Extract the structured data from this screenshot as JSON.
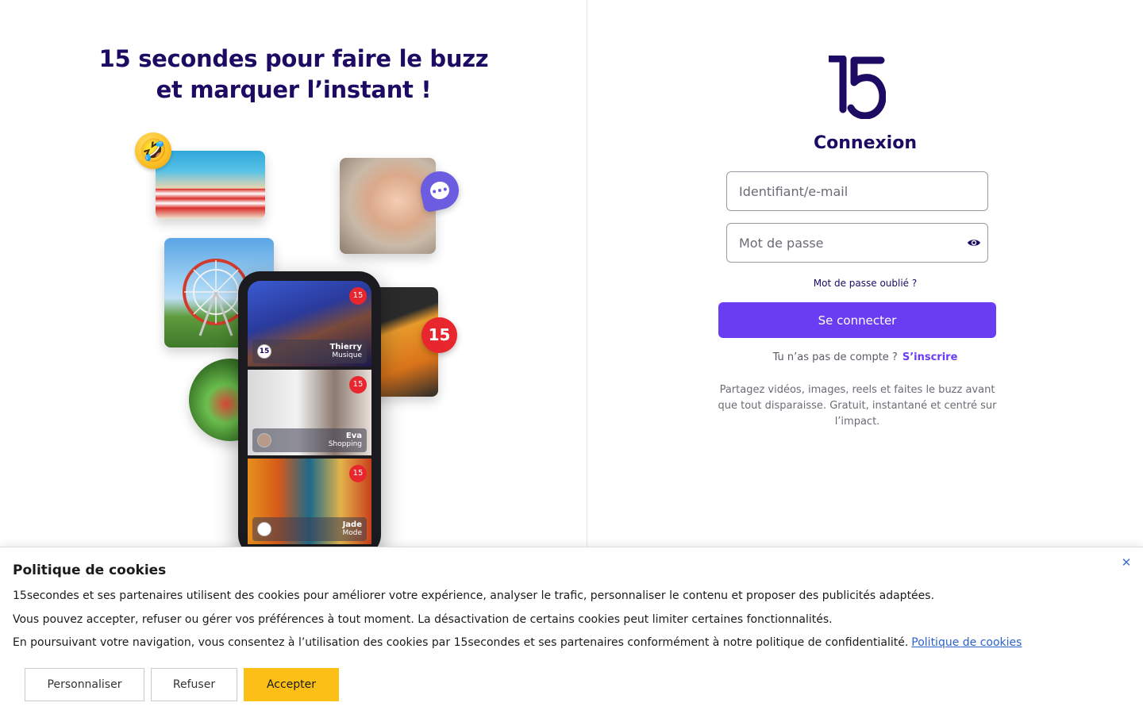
{
  "hero": {
    "title_line1": "15 secondes pour faire le buzz",
    "title_line2": "et marquer l’instant !",
    "emoji": "🤣",
    "badge_logo": "15",
    "phone_cards": [
      {
        "name": "Thierry",
        "category": "Musique",
        "badge": "15"
      },
      {
        "name": "Eva",
        "category": "Shopping",
        "badge": "15"
      },
      {
        "name": "Jade",
        "category": "Mode",
        "badge": "15"
      }
    ]
  },
  "login": {
    "title": "Connexion",
    "login_placeholder": "Identifiant/e-mail",
    "password_placeholder": "Mot de passe",
    "forgot_password": "Mot de passe oublié ?",
    "submit_label": "Se connecter",
    "no_account_text": "Tu n’as pas de compte ?",
    "signup_link": "S’inscrire",
    "tagline": "Partagez vidéos, images, reels et faites le buzz avant que tout disparaisse. Gratuit, instantané et centré sur l’impact."
  },
  "cookie": {
    "title": "Politique de cookies",
    "close_symbol": "✕",
    "line1": "15secondes et ses partenaires utilisent des cookies pour améliorer votre expérience, analyser le trafic, personnaliser le contenu et proposer des publicités adaptées.",
    "line2": "Vous pouvez accepter, refuser ou gérer vos préférences à tout moment. La désactivation de certains cookies peut limiter certaines fonctionnalités.",
    "line3": "En poursuivant votre navigation, vous consentez à l’utilisation des cookies par 15secondes et ses partenaires conformément à notre politique de confidentialité.",
    "policy_link": "Politique de cookies",
    "btn_customize": "Personnaliser",
    "btn_refuse": "Refuser",
    "btn_accept": "Accepter"
  },
  "colors": {
    "brand_dark": "#1c0a63",
    "accent_purple": "#6a3df2",
    "accept_yellow": "#fbbf16",
    "badge_red": "#e8262d",
    "link_blue": "#2b63c9"
  },
  "icons": {
    "logo": "15-logo-icon",
    "password_toggle": "eye-icon",
    "chat": "chat-bubble-icon",
    "close": "close-icon"
  }
}
